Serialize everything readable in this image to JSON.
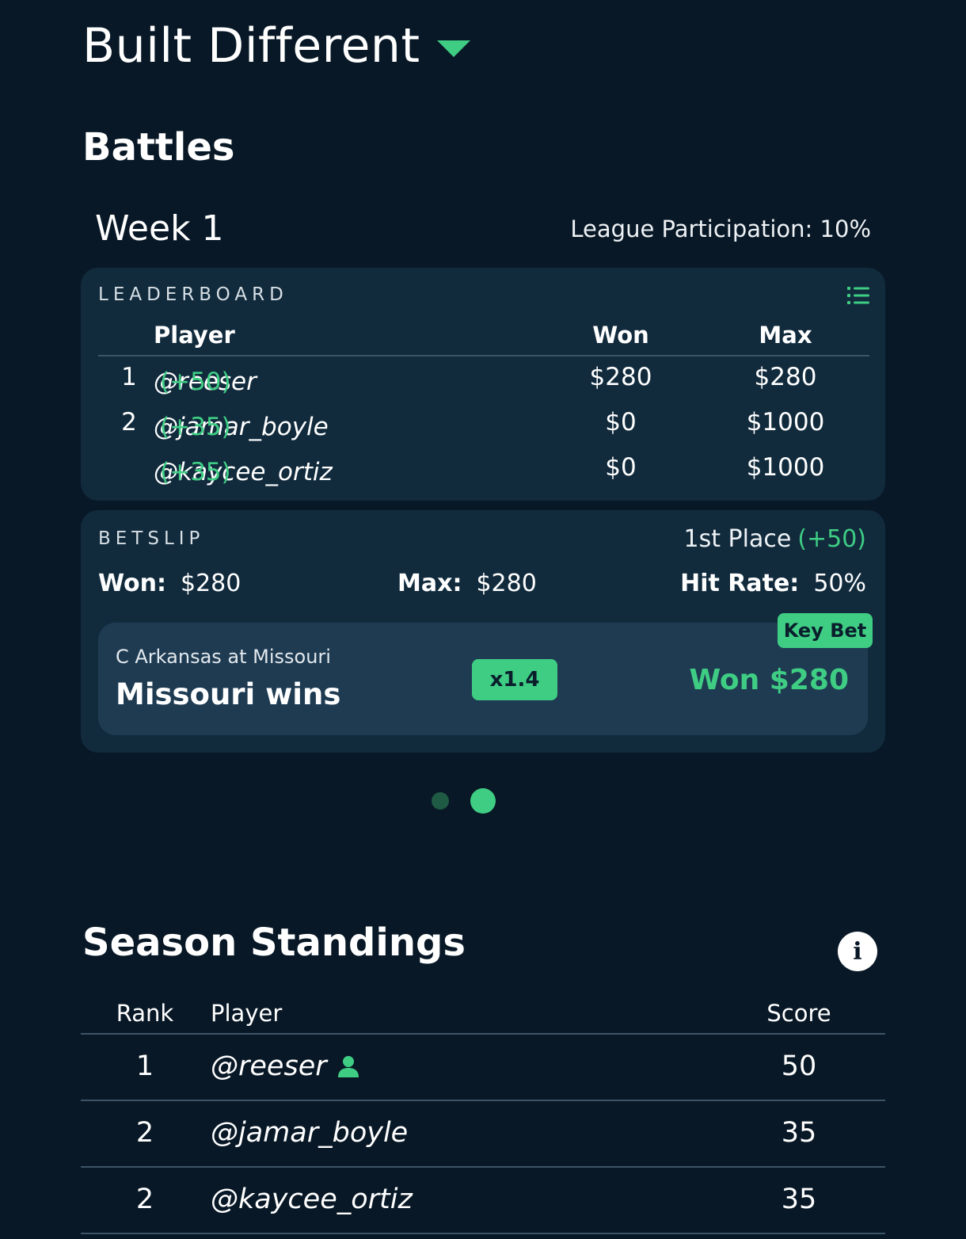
{
  "header": {
    "league_name": "Built Different",
    "section_title": "Battles"
  },
  "week": {
    "title": "Week 1",
    "participation": "League Participation: 10%"
  },
  "leaderboard": {
    "label": "LEADERBOARD",
    "columns": {
      "player": "Player",
      "won": "Won",
      "max": "Max"
    },
    "rows": [
      {
        "rank": "1",
        "player": "@reeser",
        "bonus": "(+50)",
        "won": "$280",
        "max": "$280"
      },
      {
        "rank": "2",
        "player": "@jamar_boyle",
        "bonus": "(+35)",
        "won": "$0",
        "max": "$1000"
      },
      {
        "rank": "",
        "player": "@kaycee_ortiz",
        "bonus": "(+35)",
        "won": "$0",
        "max": "$1000"
      }
    ]
  },
  "betslip": {
    "label": "BETSLIP",
    "place": "1st Place",
    "place_bonus": "(+50)",
    "won_label": "Won:",
    "won_value": "$280",
    "max_label": "Max:",
    "max_value": "$280",
    "hit_rate_label": "Hit Rate:",
    "hit_rate_value": "50%",
    "bet": {
      "game": "C Arkansas at Missouri",
      "pick": "Missouri wins",
      "multiplier": "x1.4",
      "result": "Won $280",
      "badge": "Key Bet"
    }
  },
  "pager": {
    "count": 2,
    "active_index": 1
  },
  "standings": {
    "title": "Season Standings",
    "columns": {
      "rank": "Rank",
      "player": "Player",
      "score": "Score"
    },
    "rows": [
      {
        "rank": "1",
        "player": "@reeser",
        "score": "50",
        "is_current_user": true
      },
      {
        "rank": "2",
        "player": "@jamar_boyle",
        "score": "35",
        "is_current_user": false
      },
      {
        "rank": "2",
        "player": "@kaycee_ortiz",
        "score": "35",
        "is_current_user": false
      }
    ]
  },
  "colors": {
    "background": "#081826",
    "card": "#112b3d",
    "bet_box": "#1e3b52",
    "accent": "#3fcd84"
  },
  "icons": [
    "chevron-down-icon",
    "list-icon",
    "info-icon",
    "user-icon"
  ]
}
